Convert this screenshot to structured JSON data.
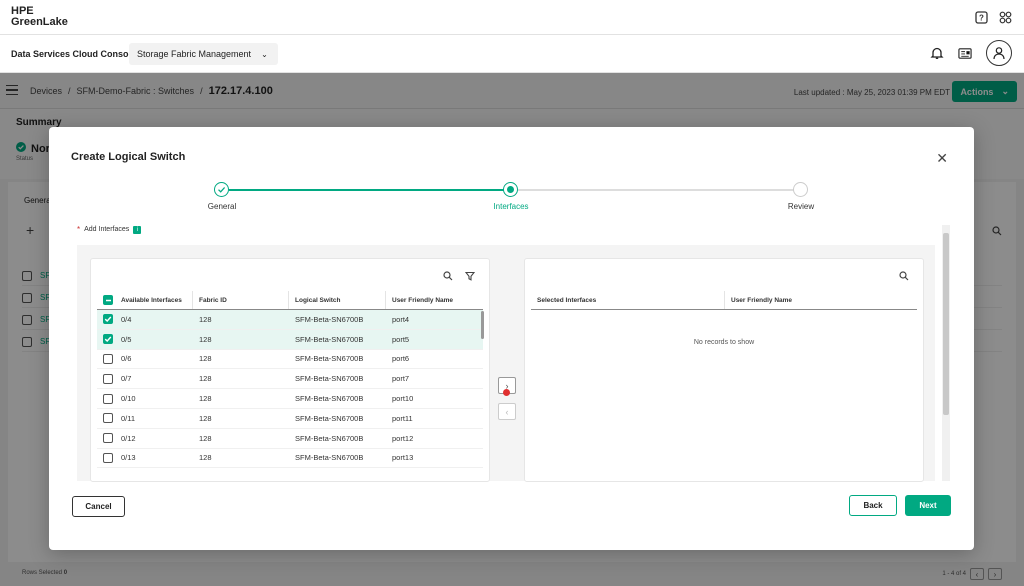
{
  "header": {
    "logo_line1": "HPE",
    "logo_line2": "GreenLake",
    "console_title": "Data Services Cloud Console",
    "app_name": "Storage Fabric Management"
  },
  "breadcrumb": {
    "items": [
      "Devices",
      "SFM-Demo-Fabric : Switches"
    ],
    "current": "172.17.4.100",
    "last_updated": "Last updated :  May 25, 2023 01:39 PM EDT",
    "actions_label": "Actions"
  },
  "summary": {
    "title": "Summary",
    "status": "Nor",
    "status_label": "Status"
  },
  "background_table": {
    "tab": "Genera",
    "row_prefix": "SF",
    "rows_selected_label": "Rows Selected",
    "rows_selected_value": "0",
    "page_info": "1 - 4 of 4"
  },
  "modal": {
    "title": "Create Logical Switch",
    "steps": [
      {
        "label": "General",
        "state": "done"
      },
      {
        "label": "Interfaces",
        "state": "active"
      },
      {
        "label": "Review",
        "state": "pending"
      }
    ],
    "add_interfaces_label": "Add Interfaces",
    "info_badge": "i",
    "left_grid": {
      "columns": [
        "Available Interfaces",
        "Fabric ID",
        "Logical Switch",
        "User Friendly Name"
      ],
      "rows": [
        {
          "iface": "0/4",
          "fabric": "128",
          "switch": "SFM-Beta-SN6700B",
          "name": "port4",
          "checked": true
        },
        {
          "iface": "0/5",
          "fabric": "128",
          "switch": "SFM-Beta-SN6700B",
          "name": "port5",
          "checked": true
        },
        {
          "iface": "0/6",
          "fabric": "128",
          "switch": "SFM-Beta-SN6700B",
          "name": "port6",
          "checked": false
        },
        {
          "iface": "0/7",
          "fabric": "128",
          "switch": "SFM-Beta-SN6700B",
          "name": "port7",
          "checked": false
        },
        {
          "iface": "0/10",
          "fabric": "128",
          "switch": "SFM-Beta-SN6700B",
          "name": "port10",
          "checked": false
        },
        {
          "iface": "0/11",
          "fabric": "128",
          "switch": "SFM-Beta-SN6700B",
          "name": "port11",
          "checked": false
        },
        {
          "iface": "0/12",
          "fabric": "128",
          "switch": "SFM-Beta-SN6700B",
          "name": "port12",
          "checked": false
        },
        {
          "iface": "0/13",
          "fabric": "128",
          "switch": "SFM-Beta-SN6700B",
          "name": "port13",
          "checked": false
        }
      ]
    },
    "right_grid": {
      "columns": [
        "Selected Interfaces",
        "User Friendly Name"
      ],
      "empty_message": "No records to show"
    },
    "buttons": {
      "cancel": "Cancel",
      "back": "Back",
      "next": "Next"
    }
  },
  "colors": {
    "accent": "#01a982"
  }
}
